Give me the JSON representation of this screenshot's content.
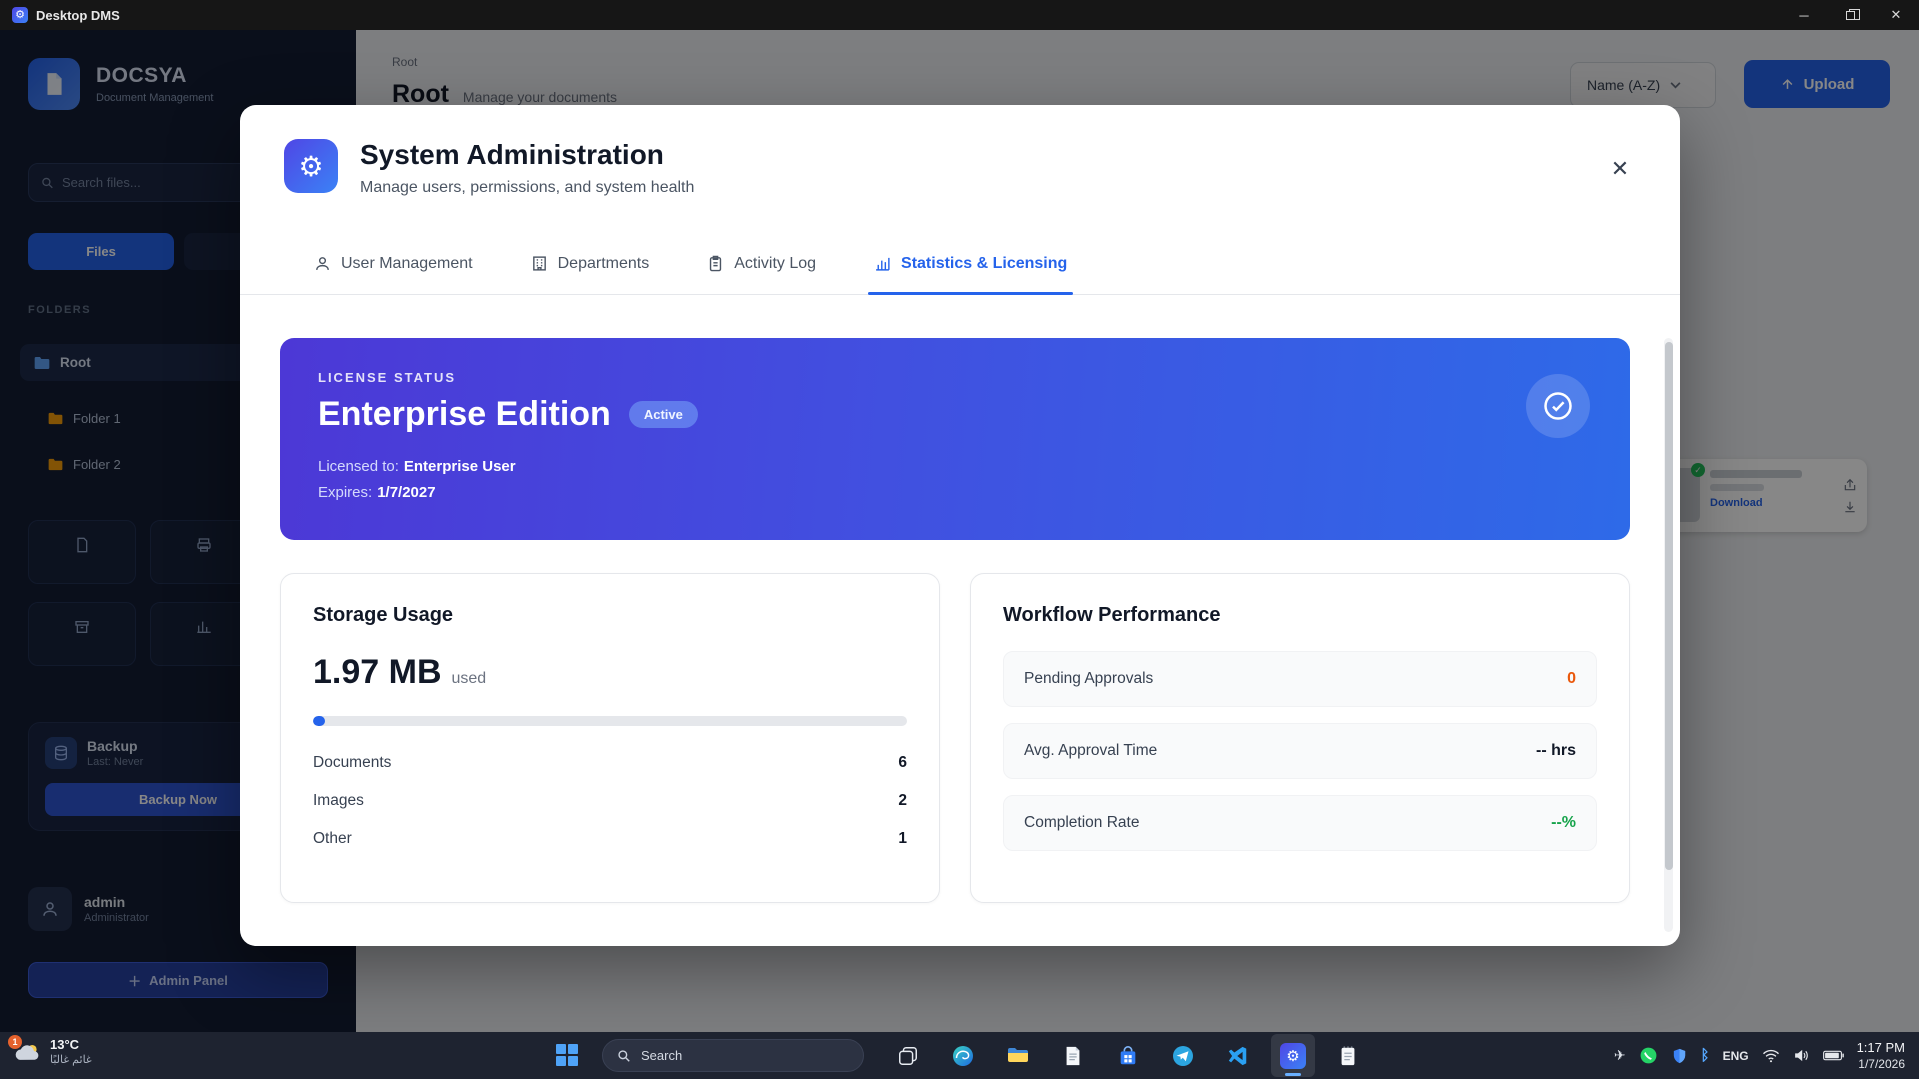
{
  "titlebar": {
    "title": "Desktop DMS"
  },
  "sidebar": {
    "brand": {
      "name": "DOCSYA",
      "tagline": "Document Management"
    },
    "search_placeholder": "Search files...",
    "buttons": {
      "primary": "Files",
      "secondary": ""
    },
    "folders_label": "FOLDERS",
    "tree": {
      "root": "Root",
      "children": [
        "Folder 1",
        "Folder 2"
      ]
    },
    "tiles": [
      {
        "label": ""
      },
      {
        "label": ""
      },
      {
        "label": ""
      },
      {
        "label": ""
      }
    ],
    "backup": {
      "title": "Backup",
      "subtitle": "Last: Never",
      "button": "Backup Now"
    },
    "user": {
      "name": "admin",
      "role": "Administrator"
    },
    "bottom_button": "Admin Panel"
  },
  "main": {
    "breadcrumb": "Root",
    "title": "Root",
    "subtitle": "Manage your documents",
    "sort_label": "Name (A-Z)",
    "upload_label": "Upload",
    "doc_card": {
      "link": "Download"
    }
  },
  "modal": {
    "title": "System Administration",
    "subtitle": "Manage users, permissions, and system health",
    "tabs": [
      {
        "label": "User Management"
      },
      {
        "label": "Departments"
      },
      {
        "label": "Activity Log"
      },
      {
        "label": "Statistics & Licensing"
      }
    ],
    "license": {
      "heading": "LICENSE STATUS",
      "edition": "Enterprise Edition",
      "badge": "Active",
      "licensed_to_label": "Licensed to:",
      "licensed_to_value": "Enterprise User",
      "expires_label": "Expires:",
      "expires_value": "1/7/2027"
    },
    "storage": {
      "title": "Storage Usage",
      "amount": "1.97 MB",
      "unit": "used",
      "rows": [
        {
          "label": "Documents",
          "value": "6"
        },
        {
          "label": "Images",
          "value": "2"
        },
        {
          "label": "Other",
          "value": "1"
        }
      ]
    },
    "workflow": {
      "title": "Workflow Performance",
      "rows": [
        {
          "label": "Pending Approvals",
          "value": "0",
          "color": "#ea580c"
        },
        {
          "label": "Avg. Approval Time",
          "value": "-- hrs",
          "color": "#111827"
        },
        {
          "label": "Completion Rate",
          "value": "--%",
          "color": "#16a34a"
        }
      ]
    }
  },
  "taskbar": {
    "weather": {
      "badge": "1",
      "temp": "13°C",
      "condition": "غائم غالبًا"
    },
    "search_label": "Search",
    "tray": {
      "language": "ENG",
      "time": "1:17 PM",
      "date": "1/7/2026"
    }
  },
  "colors": {
    "accent": "#2563eb",
    "license_start": "#4c38d6",
    "license_end": "#2e6ae8",
    "pending": "#ea580c",
    "success": "#16a34a"
  }
}
